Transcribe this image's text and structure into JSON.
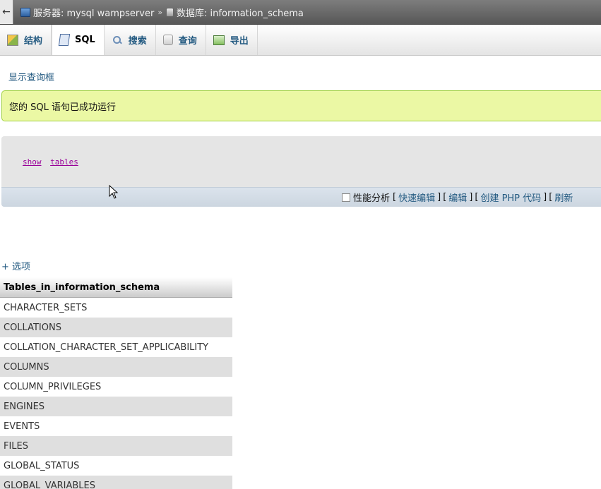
{
  "breadcrumb": {
    "back_icon": "←",
    "server_label": "服务器: mysql wampserver",
    "separator": "»",
    "db_label": "数据库: information_schema"
  },
  "tabs": [
    {
      "label": "结构",
      "icon": "structure-icon"
    },
    {
      "label": "SQL",
      "icon": "sql-icon",
      "active": true
    },
    {
      "label": "搜索",
      "icon": "search-icon"
    },
    {
      "label": "查询",
      "icon": "query-icon"
    },
    {
      "label": "导出",
      "icon": "export-icon"
    }
  ],
  "show_query_link": "显示查询框",
  "success_message": "您的 SQL 语句已成功运行",
  "sql": {
    "keyword1": "show",
    "keyword2": "tables"
  },
  "sql_toolbar": {
    "profiling_label": "性能分析",
    "open_bracket": "[",
    "close_bracket": "]",
    "quick_edit": "快速编辑",
    "edit": "编辑",
    "create_php": "创建 PHP 代码",
    "refresh": "刷新"
  },
  "options_link": "+ 选项",
  "results_table": {
    "header": "Tables_in_information_schema",
    "rows": [
      "CHARACTER_SETS",
      "COLLATIONS",
      "COLLATION_CHARACTER_SET_APPLICABILITY",
      "COLUMNS",
      "COLUMN_PRIVILEGES",
      "ENGINES",
      "EVENTS",
      "FILES",
      "GLOBAL_STATUS",
      "GLOBAL_VARIABLES"
    ]
  },
  "colors": {
    "link": "#235a81",
    "success_bg": "#ebf8a4",
    "success_border": "#a2d246",
    "sql_keyword": "#990099"
  }
}
